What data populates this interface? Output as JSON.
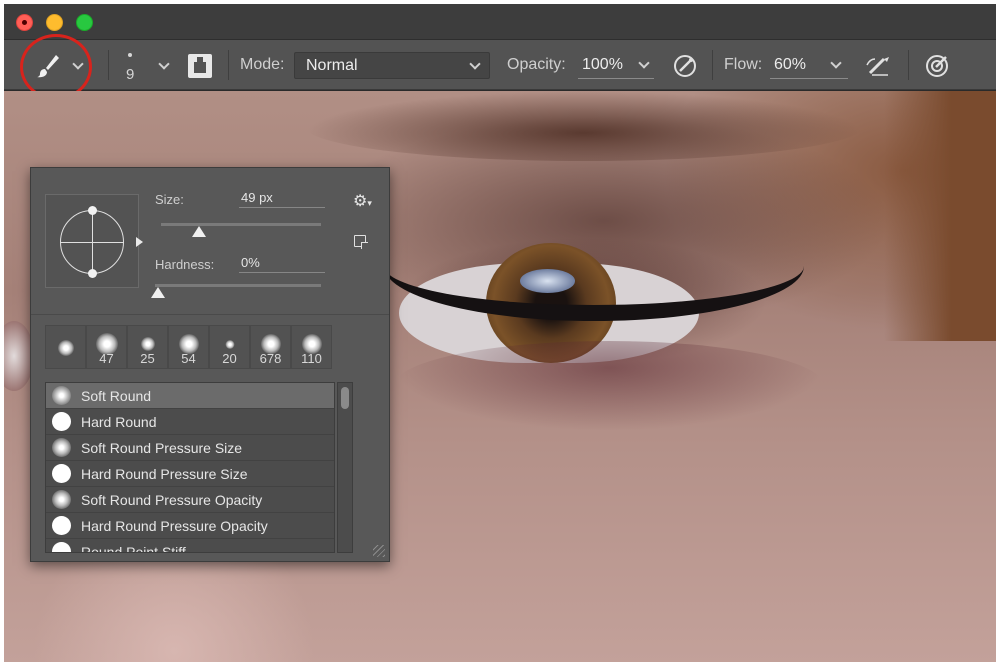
{
  "window": {
    "controls": [
      "close",
      "minimize",
      "maximize"
    ]
  },
  "options_bar": {
    "brush_tool_icon": "brush-icon",
    "brush_size": "9",
    "mode_label": "Mode:",
    "mode_value": "Normal",
    "opacity_label": "Opacity:",
    "opacity_value": "100%",
    "flow_label": "Flow:",
    "flow_value": "60%",
    "highlight_color": "#d8231c"
  },
  "brush_panel": {
    "size_label": "Size:",
    "size_value": "49 px",
    "hardness_label": "Hardness:",
    "hardness_value": "0%",
    "size_slider_fraction": 0.24,
    "hardness_slider_fraction": 0.0,
    "recent_brushes": [
      {
        "label": "",
        "kind": "soft"
      },
      {
        "label": "47",
        "kind": "soft"
      },
      {
        "label": "25",
        "kind": "soft"
      },
      {
        "label": "54",
        "kind": "soft"
      },
      {
        "label": "20",
        "kind": "soft"
      },
      {
        "label": "678",
        "kind": "soft"
      },
      {
        "label": "110",
        "kind": "soft"
      }
    ],
    "presets": [
      {
        "label": "Soft Round",
        "kind": "soft",
        "selected": true
      },
      {
        "label": "Hard Round",
        "kind": "hard",
        "selected": false
      },
      {
        "label": "Soft Round Pressure Size",
        "kind": "soft",
        "selected": false
      },
      {
        "label": "Hard Round Pressure Size",
        "kind": "hard",
        "selected": false
      },
      {
        "label": "Soft Round Pressure Opacity",
        "kind": "soft",
        "selected": false
      },
      {
        "label": "Hard Round Pressure Opacity",
        "kind": "hard",
        "selected": false
      },
      {
        "label": "Round Point Stiff",
        "kind": "hard",
        "selected": false
      }
    ]
  }
}
